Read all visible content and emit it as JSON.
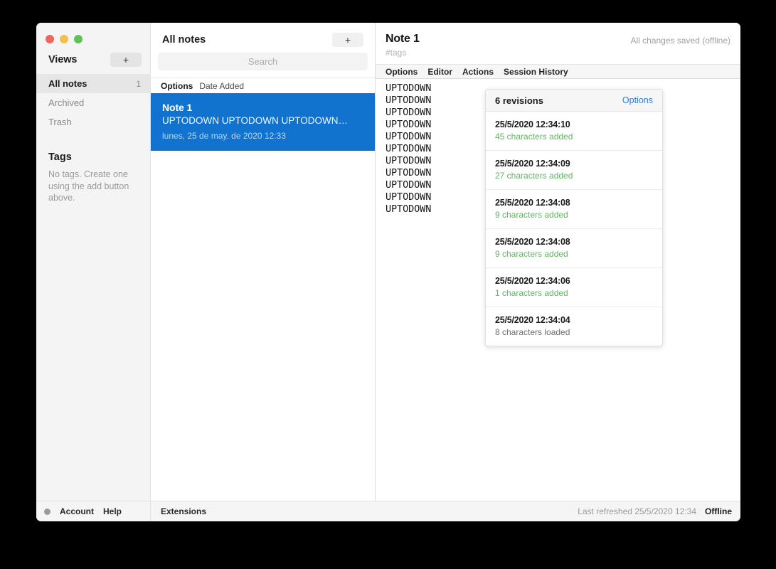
{
  "window": {
    "traffic_lights": [
      "close",
      "minimize",
      "zoom"
    ],
    "colors": {
      "accent_blue": "#1273cf",
      "link_blue": "#2f7fd4",
      "added_green": "#5fb75f",
      "sidebar_bg": "#f4f4f4",
      "close_red": "#f0655c",
      "minimize_yellow": "#f5bf4f",
      "zoom_green": "#5ec45a"
    }
  },
  "sidebar": {
    "views_title": "Views",
    "add_view_label": "+",
    "items": [
      {
        "label": "All notes",
        "count": "1",
        "active": true
      },
      {
        "label": "Archived",
        "count": "",
        "active": false
      },
      {
        "label": "Trash",
        "count": "",
        "active": false
      }
    ],
    "tags_title": "Tags",
    "tags_empty": "No tags. Create one using the add button above."
  },
  "notes_list": {
    "header_title": "All notes",
    "add_note_label": "+",
    "search": {
      "value": "",
      "placeholder": "Search"
    },
    "sort_bar": {
      "options_label": "Options",
      "sort_value": "Date Added"
    },
    "notes": [
      {
        "title": "Note 1",
        "preview": "UPTODOWN UPTODOWN UPTODOWN…",
        "date": "lunes, 25 de may. de 2020 12:33",
        "selected": true
      }
    ]
  },
  "detail": {
    "title": "Note 1",
    "save_status": "All changes saved (offline)",
    "tags_placeholder": "#tags",
    "tabs": [
      {
        "label": "Options"
      },
      {
        "label": "Editor"
      },
      {
        "label": "Actions"
      },
      {
        "label": "Session History"
      }
    ],
    "editor_text": "UPTODOWN\nUPTODOWN\nUPTODOWN\nUPTODOWN\nUPTODOWN\nUPTODOWN\nUPTODOWN\nUPTODOWN\nUPTODOWN\nUPTODOWN\nUPTODOWN"
  },
  "revisions": {
    "count_label": "6 revisions",
    "options_label": "Options",
    "rows": [
      {
        "time": "25/5/2020 12:34:10",
        "meta": "45 characters added",
        "kind": "added"
      },
      {
        "time": "25/5/2020 12:34:09",
        "meta": "27 characters added",
        "kind": "added"
      },
      {
        "time": "25/5/2020 12:34:08",
        "meta": "9 characters added",
        "kind": "added"
      },
      {
        "time": "25/5/2020 12:34:08",
        "meta": "9 characters added",
        "kind": "added"
      },
      {
        "time": "25/5/2020 12:34:06",
        "meta": "1 characters added",
        "kind": "added"
      },
      {
        "time": "25/5/2020 12:34:04",
        "meta": "8 characters loaded",
        "kind": "loaded"
      }
    ]
  },
  "footer": {
    "account_label": "Account",
    "help_label": "Help",
    "extensions_label": "Extensions",
    "last_refreshed": "Last refreshed 25/5/2020 12:34",
    "connection_status": "Offline"
  }
}
